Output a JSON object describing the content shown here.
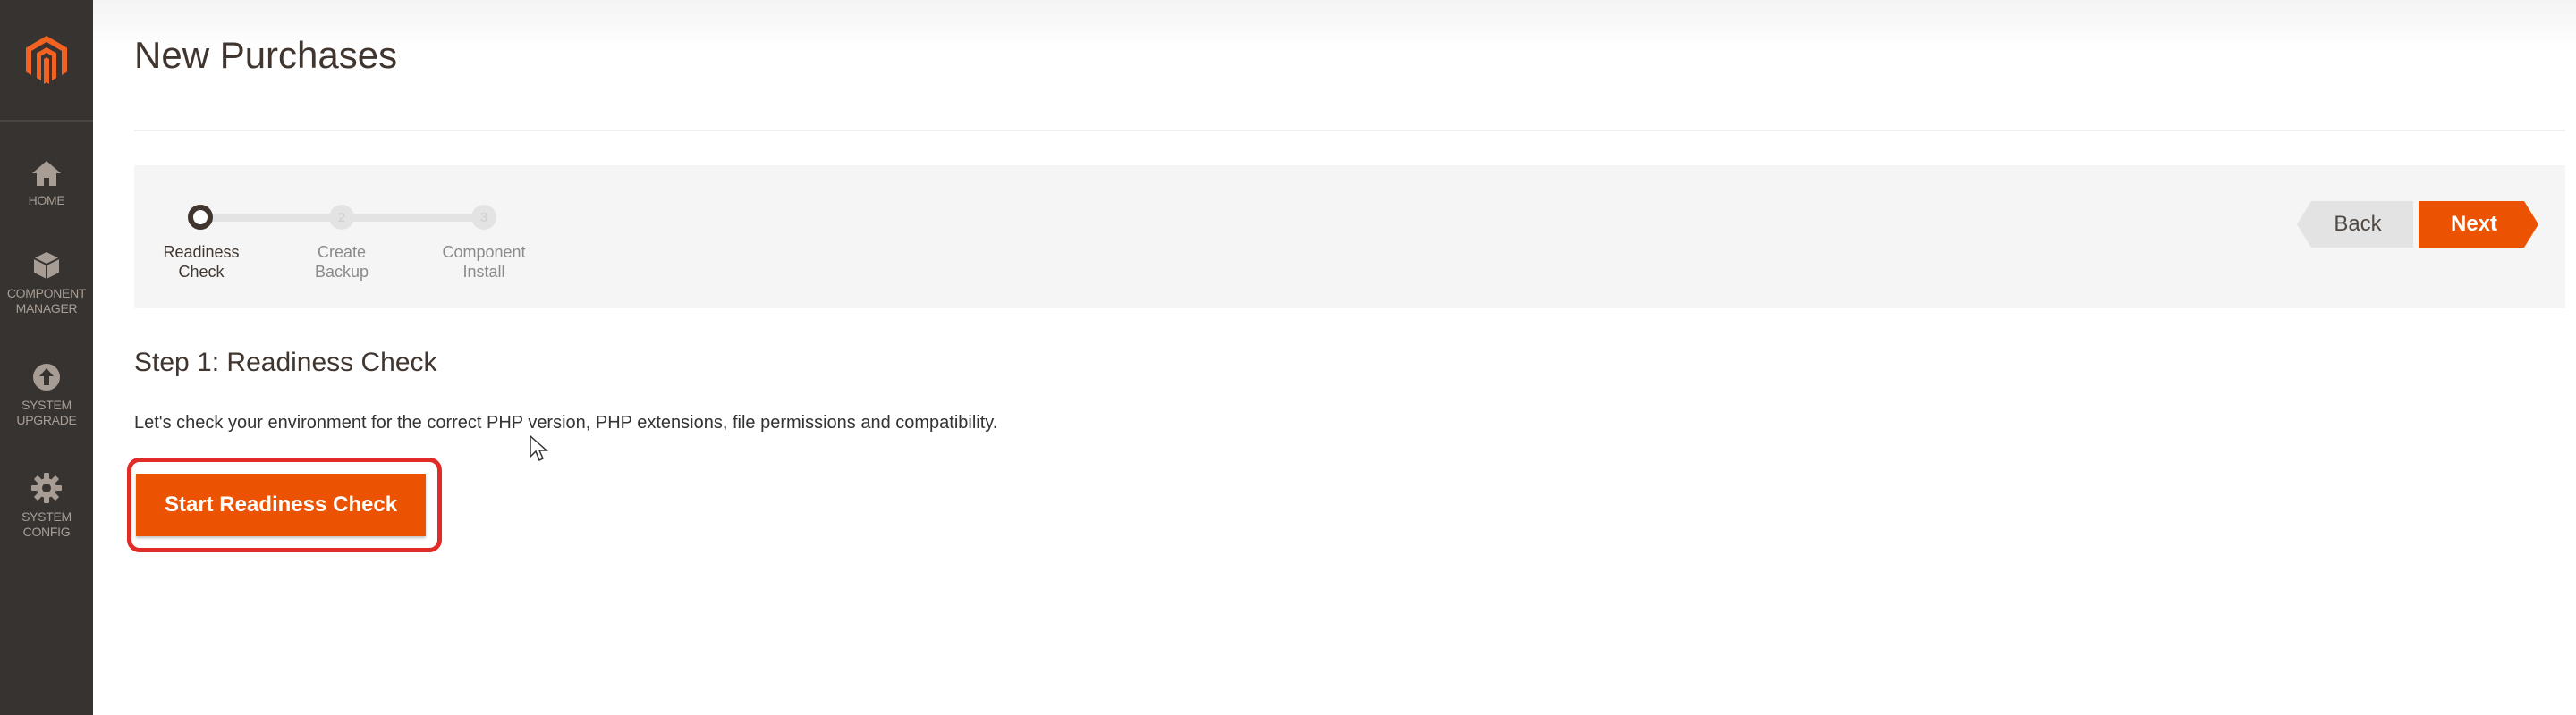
{
  "sidebar": {
    "logo_icon": "magento-logo",
    "items": [
      {
        "label": "HOME",
        "icon": "home-icon"
      },
      {
        "label": "COMPONENT\nMANAGER",
        "icon": "box-icon"
      },
      {
        "label": "SYSTEM\nUPGRADE",
        "icon": "upload-icon"
      },
      {
        "label": "SYSTEM\nCONFIG",
        "icon": "gear-icon"
      }
    ]
  },
  "page": {
    "title": "New Purchases"
  },
  "wizard": {
    "steps": [
      {
        "number": "",
        "label": "Readiness\nCheck",
        "active": true
      },
      {
        "number": "2",
        "label": "Create\nBackup",
        "active": false
      },
      {
        "number": "3",
        "label": "Component\nInstall",
        "active": false
      }
    ],
    "back_label": "Back",
    "next_label": "Next"
  },
  "content": {
    "step_heading": "Step 1: Readiness Check",
    "description": "Let's check your environment for the correct PHP version, PHP extensions, file permissions and compatibility.",
    "start_button": "Start Readiness Check"
  },
  "colors": {
    "accent": "#eb5202",
    "sidebar_bg": "#373330",
    "highlight": "#e02b27"
  }
}
